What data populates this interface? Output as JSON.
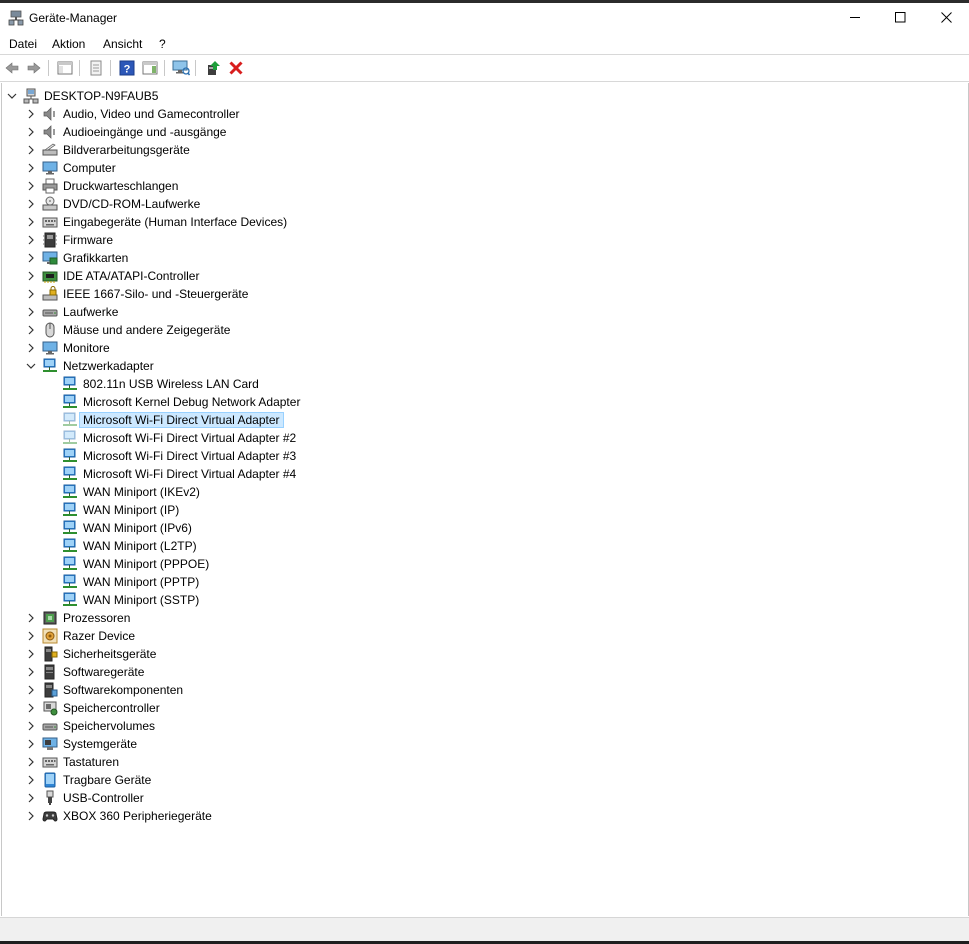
{
  "window": {
    "title": "Geräte-Manager",
    "controls": [
      "minimize",
      "maximize",
      "close"
    ]
  },
  "menu": [
    "Datei",
    "Aktion",
    "Ansicht",
    "?"
  ],
  "toolbar": {
    "buttons": [
      "back-icon",
      "forward-icon",
      "show-hide-console-tree-icon",
      "properties-icon",
      "help-icon",
      "action-pane-icon",
      "scan-hardware-icon",
      "update-driver-icon",
      "uninstall-icon"
    ]
  },
  "tree": {
    "root": "DESKTOP-N9FAUB5",
    "categories": [
      {
        "label": "Audio, Video und Gamecontroller",
        "icon": "speaker-icon"
      },
      {
        "label": "Audioeingänge und -ausgänge",
        "icon": "speaker-icon"
      },
      {
        "label": "Bildverarbeitungsgeräte",
        "icon": "scanner-icon"
      },
      {
        "label": "Computer",
        "icon": "monitor-icon"
      },
      {
        "label": "Druckwarteschlangen",
        "icon": "printer-icon"
      },
      {
        "label": "DVD/CD-ROM-Laufwerke",
        "icon": "dvd-icon"
      },
      {
        "label": "Eingabegeräte (Human Interface Devices)",
        "icon": "keyboard-icon"
      },
      {
        "label": "Firmware",
        "icon": "chip-icon"
      },
      {
        "label": "Grafikkarten",
        "icon": "display-adapter-icon"
      },
      {
        "label": "IDE ATA/ATAPI-Controller",
        "icon": "controller-icon"
      },
      {
        "label": "IEEE 1667-Silo- und -Steuergeräte",
        "icon": "lock-icon"
      },
      {
        "label": "Laufwerke",
        "icon": "drive-icon"
      },
      {
        "label": "Mäuse und andere Zeigegeräte",
        "icon": "mouse-icon"
      },
      {
        "label": "Monitore",
        "icon": "monitor-icon"
      },
      {
        "label": "Netzwerkadapter",
        "icon": "network-icon"
      }
    ],
    "network_children": [
      "802.11n USB Wireless LAN Card",
      "Microsoft Kernel Debug Network Adapter",
      "Microsoft Wi-Fi Direct Virtual Adapter",
      "Microsoft Wi-Fi Direct Virtual Adapter #2",
      "Microsoft Wi-Fi Direct Virtual Adapter #3",
      "Microsoft Wi-Fi Direct Virtual Adapter #4",
      "WAN Miniport (IKEv2)",
      "WAN Miniport (IP)",
      "WAN Miniport (IPv6)",
      "WAN Miniport (L2TP)",
      "WAN Miniport (PPPOE)",
      "WAN Miniport (PPTP)",
      "WAN Miniport (SSTP)"
    ],
    "selected_child": "Microsoft Wi-Fi Direct Virtual Adapter",
    "categories_after": [
      {
        "label": "Prozessoren",
        "icon": "processor-icon"
      },
      {
        "label": "Razer Device",
        "icon": "razer-icon"
      },
      {
        "label": "Sicherheitsgeräte",
        "icon": "security-device-icon"
      },
      {
        "label": "Softwaregeräte",
        "icon": "software-device-icon"
      },
      {
        "label": "Softwarekomponenten",
        "icon": "software-component-icon"
      },
      {
        "label": "Speichercontroller",
        "icon": "storage-controller-icon"
      },
      {
        "label": "Speichervolumes",
        "icon": "drive-icon"
      },
      {
        "label": "Systemgeräte",
        "icon": "system-device-icon"
      },
      {
        "label": "Tastaturen",
        "icon": "keyboard-icon"
      },
      {
        "label": "Tragbare Geräte",
        "icon": "portable-device-icon"
      },
      {
        "label": "USB-Controller",
        "icon": "usb-icon"
      },
      {
        "label": "XBOX 360 Peripheriegeräte",
        "icon": "gamepad-icon"
      }
    ]
  },
  "colors": {
    "selection_bg": "#cce8ff",
    "selection_border": "#99d1ff",
    "network_icon": "#2f86d6",
    "uninstall_red": "#d81e1e"
  }
}
